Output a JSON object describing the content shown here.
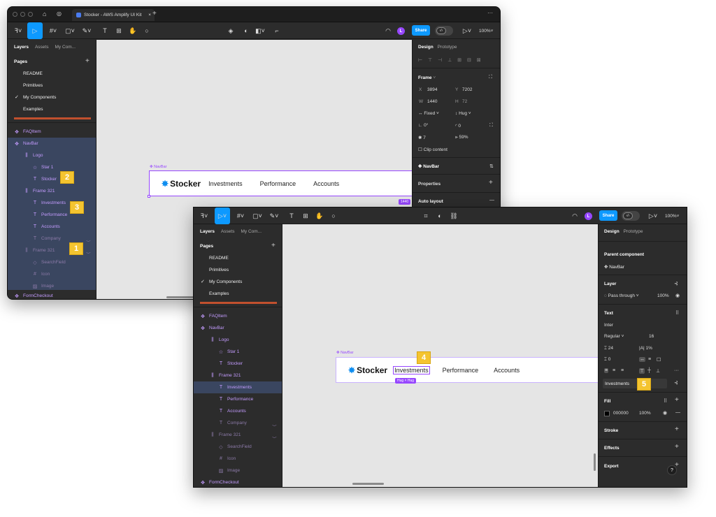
{
  "window1": {
    "tab_title": "Stocker - AWS Amplify UI Kit",
    "zoom": "100%",
    "share": "Share",
    "avatar": "L",
    "left_tabs": [
      "Layers",
      "Assets",
      "My Com..."
    ],
    "pages_header": "Pages",
    "pages": [
      "README",
      "Primitives",
      "My Components",
      "Examples"
    ],
    "layers": [
      {
        "label": "FAQItem",
        "icon": "✥"
      },
      {
        "label": "NavBar",
        "icon": "✥"
      },
      {
        "label": "Logo",
        "icon": "⫼"
      },
      {
        "label": "Star 1",
        "icon": "☆"
      },
      {
        "label": "Stocker",
        "icon": "T"
      },
      {
        "label": "Frame 321",
        "icon": "⫼"
      },
      {
        "label": "Investments",
        "icon": "T"
      },
      {
        "label": "Performance",
        "icon": "T"
      },
      {
        "label": "Accounts",
        "icon": "T"
      },
      {
        "label": "Company",
        "icon": "T"
      },
      {
        "label": "Frame 321",
        "icon": "⫼"
      },
      {
        "label": "SearchField",
        "icon": "◇"
      },
      {
        "label": "Icon",
        "icon": "#"
      },
      {
        "label": "Image",
        "icon": "▨"
      },
      {
        "label": "FormCheckout",
        "icon": "✥"
      }
    ],
    "right_tabs": [
      "Design",
      "Prototype"
    ],
    "frame_header": "Frame",
    "x_label": "X",
    "x_value": "3894",
    "y_label": "Y",
    "y_value": "7202",
    "w_label": "W",
    "w_value": "1440",
    "h_label": "H",
    "h_value": "72",
    "width_mode": "Fixed",
    "height_mode": "Hug",
    "rotation": "0°",
    "radius": "0",
    "blend_value": "7",
    "opacity": "59%",
    "clip_content": "Clip content",
    "component_name": "NavBar",
    "properties": "Properties",
    "auto_layout": "Auto layout",
    "canvas_label": "NavBar",
    "width_tag": "1440",
    "navbar": {
      "logo": "Stocker",
      "links": [
        "Investments",
        "Performance",
        "Accounts"
      ]
    }
  },
  "window2": {
    "zoom": "100%",
    "share": "Share",
    "avatar": "L",
    "left_tabs": [
      "Layers",
      "Assets",
      "My Com..."
    ],
    "pages_header": "Pages",
    "pages": [
      "README",
      "Primitives",
      "My Components",
      "Examples"
    ],
    "layers": [
      {
        "label": "FAQItem",
        "icon": "✥"
      },
      {
        "label": "NavBar",
        "icon": "✥"
      },
      {
        "label": "Logo",
        "icon": "⫼"
      },
      {
        "label": "Star 1",
        "icon": "☆"
      },
      {
        "label": "Stocker",
        "icon": "T"
      },
      {
        "label": "Frame 321",
        "icon": "⫼"
      },
      {
        "label": "Investments",
        "icon": "T"
      },
      {
        "label": "Performance",
        "icon": "T"
      },
      {
        "label": "Accounts",
        "icon": "T"
      },
      {
        "label": "Company",
        "icon": "T"
      },
      {
        "label": "Frame 321",
        "icon": "⫼"
      },
      {
        "label": "SearchField",
        "icon": "◇"
      },
      {
        "label": "Icon",
        "icon": "#"
      },
      {
        "label": "Image",
        "icon": "▨"
      },
      {
        "label": "FormCheckout",
        "icon": "✥"
      }
    ],
    "right_tabs": [
      "Design",
      "Prototype"
    ],
    "parent_component_header": "Parent component",
    "parent_component": "NavBar",
    "layer_header": "Layer",
    "blend_mode": "Pass through",
    "layer_opacity": "100%",
    "text_header": "Text",
    "font_family": "Inter",
    "font_weight": "Regular",
    "font_size": "16",
    "line_height": "24",
    "letter_spacing": "1%",
    "paragraph_spacing": "0",
    "text_content": "Investments",
    "fill_header": "Fill",
    "fill_hex": "000000",
    "fill_opacity": "100%",
    "stroke_header": "Stroke",
    "effects_header": "Effects",
    "export_header": "Export",
    "help": "?",
    "canvas_label": "NavBar",
    "size_tag": "Hug × Hug",
    "navbar": {
      "logo": "Stocker",
      "links": [
        "Investments",
        "Performance",
        "Accounts"
      ]
    }
  },
  "badges": [
    "1",
    "2",
    "3",
    "4",
    "5"
  ]
}
